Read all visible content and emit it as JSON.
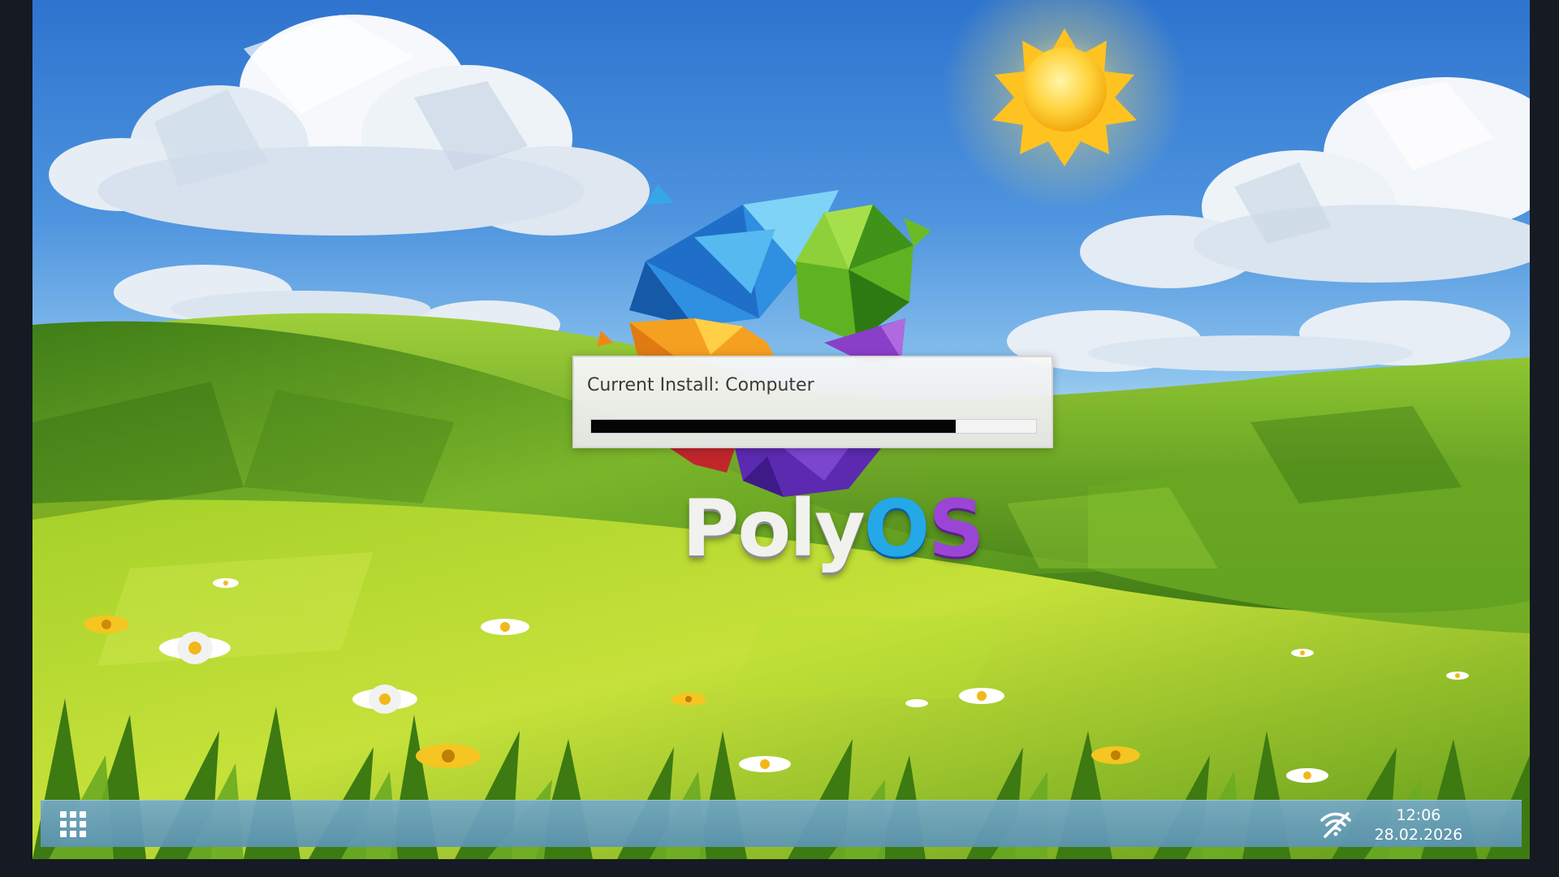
{
  "install_dialog": {
    "label": "Current Install: Computer",
    "progress": 0.82
  },
  "brand": {
    "name_part1": "Poly",
    "name_o": "O",
    "name_s": "S"
  },
  "taskbar": {
    "apps_icon": "apps-grid-icon",
    "network_icon": "wifi-disconnected-icon",
    "time": "12:06",
    "date": "28.02.2026"
  },
  "colors": {
    "taskbar": "#6ea4c4",
    "progress_fill": "#050505",
    "logo_blue": "#24a8e8",
    "logo_purple": "#9b45d6"
  }
}
